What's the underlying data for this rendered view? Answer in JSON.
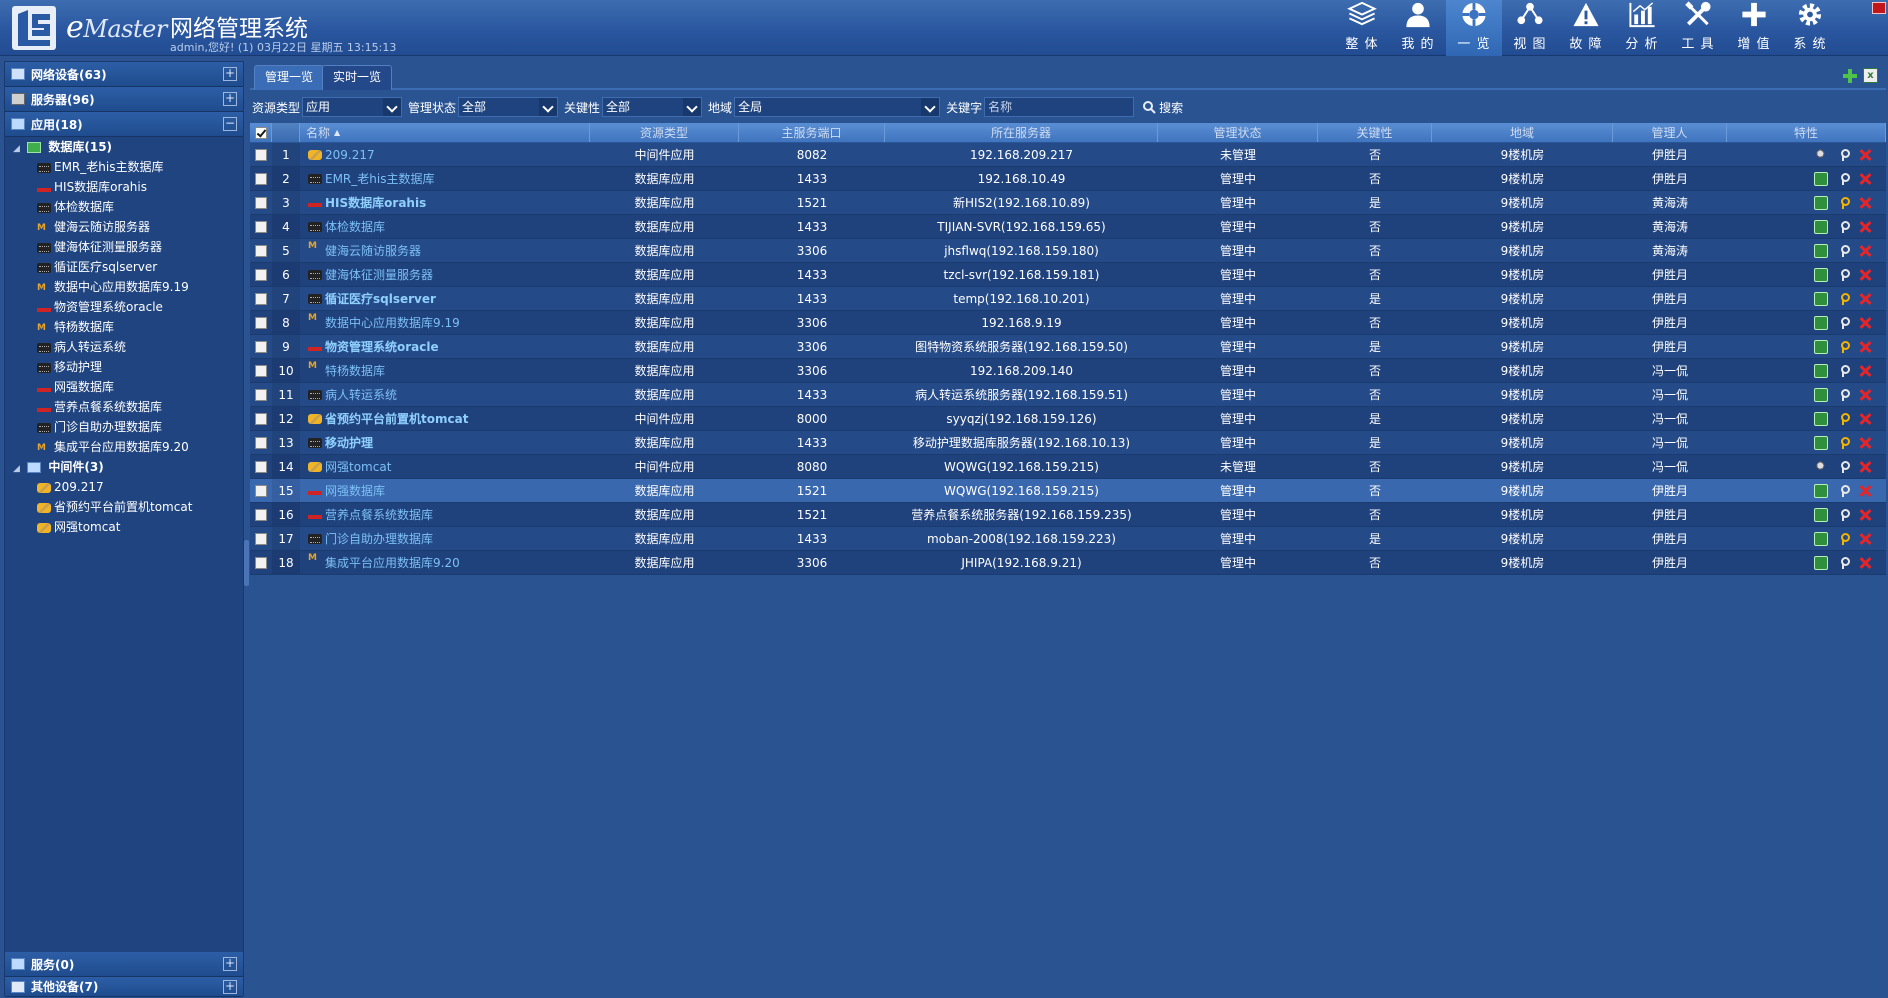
{
  "header": {
    "brand": "eMaster",
    "title": "网络管理系统",
    "subtitle": "admin,您好! (1) 03月22日 星期五 13:15:13",
    "nav": [
      {
        "label": "整 体",
        "icon": "layers-icon",
        "active": false
      },
      {
        "label": "我 的",
        "icon": "user-icon",
        "active": false
      },
      {
        "label": "一 览",
        "icon": "lifebuoy-icon",
        "active": true
      },
      {
        "label": "视 图",
        "icon": "topology-icon",
        "active": false
      },
      {
        "label": "故 障",
        "icon": "warning-icon",
        "active": false
      },
      {
        "label": "分 析",
        "icon": "chart-icon",
        "active": false
      },
      {
        "label": "工 具",
        "icon": "tools-icon",
        "active": false
      },
      {
        "label": "增 值",
        "icon": "plus-icon",
        "active": false
      },
      {
        "label": "系 统",
        "icon": "gear-icon",
        "active": false
      }
    ]
  },
  "sidebar": {
    "sections": {
      "network": "网络设备(63)",
      "servers": "服务器(96)",
      "apps": "应用(18)",
      "services": "服务(0)",
      "others": "其他设备(7)"
    },
    "db_group": "数据库(15)",
    "db_items": [
      {
        "label": "EMR_老his主数据库",
        "icon": "sqlserver"
      },
      {
        "label": "HIS数据库orahis",
        "icon": "oracle"
      },
      {
        "label": "体检数据库",
        "icon": "sqlserver"
      },
      {
        "label": "健海云随访服务器",
        "icon": "mysql"
      },
      {
        "label": "健海体征测量服务器",
        "icon": "sqlserver"
      },
      {
        "label": "循证医疗sqlserver",
        "icon": "sqlserver"
      },
      {
        "label": "数据中心应用数据库9.19",
        "icon": "mysql"
      },
      {
        "label": "物资管理系统oracle",
        "icon": "oracle"
      },
      {
        "label": "特杨数据库",
        "icon": "mysql"
      },
      {
        "label": "病人转运系统",
        "icon": "sqlserver"
      },
      {
        "label": "移动护理",
        "icon": "sqlserver"
      },
      {
        "label": "网强数据库",
        "icon": "oracle"
      },
      {
        "label": "营养点餐系统数据库",
        "icon": "oracle"
      },
      {
        "label": "门诊自助办理数据库",
        "icon": "sqlserver"
      },
      {
        "label": "集成平台应用数据库9.20",
        "icon": "mysql"
      }
    ],
    "mw_group": "中间件(3)",
    "mw_items": [
      {
        "label": "209.217",
        "icon": "tomcat"
      },
      {
        "label": "省预约平台前置机tomcat",
        "icon": "tomcat"
      },
      {
        "label": "网强tomcat",
        "icon": "tomcat"
      }
    ]
  },
  "tabs": [
    "管理一览",
    "实时一览"
  ],
  "filters": {
    "type_label": "资源类型",
    "type_value": "应用",
    "mgmt_label": "管理状态",
    "mgmt_value": "全部",
    "key_label": "关键性",
    "key_value": "全部",
    "region_label": "地域",
    "region_value": "全局",
    "keyword_label": "关键字",
    "keyword_placeholder": "名称",
    "search_label": "搜索"
  },
  "table": {
    "columns": [
      "名称",
      "资源类型",
      "主服务端口",
      "所在服务器",
      "管理状态",
      "关键性",
      "地域",
      "管理人",
      "特性"
    ],
    "rows": [
      {
        "no": "1",
        "name": "209.217",
        "icon": "tomcat",
        "type": "中间件应用",
        "port": "8082",
        "server": "192.168.209.217",
        "mgmt": "未管理",
        "key": "否",
        "region": "9楼机房",
        "owner": "伊胜月",
        "mon": "off",
        "keycolor": "white"
      },
      {
        "no": "2",
        "name": "EMR_老his主数据库",
        "icon": "sqlserver",
        "type": "数据库应用",
        "port": "1433",
        "server": "192.168.10.49",
        "mgmt": "管理中",
        "key": "否",
        "region": "9楼机房",
        "owner": "伊胜月",
        "mon": "on",
        "keycolor": "white"
      },
      {
        "no": "3",
        "name": "HIS数据库orahis",
        "icon": "oracle",
        "type": "数据库应用",
        "port": "1521",
        "server": "新HIS2(192.168.10.89)",
        "mgmt": "管理中",
        "key": "是",
        "region": "9楼机房",
        "owner": "黄海涛",
        "mon": "on",
        "keycolor": "gold",
        "strong": true
      },
      {
        "no": "4",
        "name": "体检数据库",
        "icon": "sqlserver",
        "type": "数据库应用",
        "port": "1433",
        "server": "TIJIAN-SVR(192.168.159.65)",
        "mgmt": "管理中",
        "key": "否",
        "region": "9楼机房",
        "owner": "黄海涛",
        "mon": "on",
        "keycolor": "white"
      },
      {
        "no": "5",
        "name": "健海云随访服务器",
        "icon": "mysql",
        "type": "数据库应用",
        "port": "3306",
        "server": "jhsflwq(192.168.159.180)",
        "mgmt": "管理中",
        "key": "否",
        "region": "9楼机房",
        "owner": "黄海涛",
        "mon": "on",
        "keycolor": "white"
      },
      {
        "no": "6",
        "name": "健海体征测量服务器",
        "icon": "sqlserver",
        "type": "数据库应用",
        "port": "1433",
        "server": "tzcl-svr(192.168.159.181)",
        "mgmt": "管理中",
        "key": "否",
        "region": "9楼机房",
        "owner": "伊胜月",
        "mon": "on",
        "keycolor": "white"
      },
      {
        "no": "7",
        "name": "循证医疗sqlserver",
        "icon": "sqlserver",
        "type": "数据库应用",
        "port": "1433",
        "server": "temp(192.168.10.201)",
        "mgmt": "管理中",
        "key": "是",
        "region": "9楼机房",
        "owner": "伊胜月",
        "mon": "on",
        "keycolor": "gold",
        "strong": true
      },
      {
        "no": "8",
        "name": "数据中心应用数据库9.19",
        "icon": "mysql",
        "type": "数据库应用",
        "port": "3306",
        "server": "192.168.9.19",
        "mgmt": "管理中",
        "key": "否",
        "region": "9楼机房",
        "owner": "伊胜月",
        "mon": "on",
        "keycolor": "white"
      },
      {
        "no": "9",
        "name": "物资管理系统oracle",
        "icon": "oracle",
        "type": "数据库应用",
        "port": "3306",
        "server": "图特物资系统服务器(192.168.159.50)",
        "mgmt": "管理中",
        "key": "是",
        "region": "9楼机房",
        "owner": "伊胜月",
        "mon": "on",
        "keycolor": "gold",
        "strong": true
      },
      {
        "no": "10",
        "name": "特杨数据库",
        "icon": "mysql",
        "type": "数据库应用",
        "port": "3306",
        "server": "192.168.209.140",
        "mgmt": "管理中",
        "key": "否",
        "region": "9楼机房",
        "owner": "冯一侃",
        "mon": "on",
        "keycolor": "white"
      },
      {
        "no": "11",
        "name": "病人转运系统",
        "icon": "sqlserver",
        "type": "数据库应用",
        "port": "1433",
        "server": "病人转运系统服务器(192.168.159.51)",
        "mgmt": "管理中",
        "key": "否",
        "region": "9楼机房",
        "owner": "冯一侃",
        "mon": "on",
        "keycolor": "white"
      },
      {
        "no": "12",
        "name": "省预约平台前置机tomcat",
        "icon": "tomcat",
        "type": "中间件应用",
        "port": "8000",
        "server": "syyqzj(192.168.159.126)",
        "mgmt": "管理中",
        "key": "是",
        "region": "9楼机房",
        "owner": "冯一侃",
        "mon": "on",
        "keycolor": "gold",
        "strong": true
      },
      {
        "no": "13",
        "name": "移动护理",
        "icon": "sqlserver",
        "type": "数据库应用",
        "port": "1433",
        "server": "移动护理数据库服务器(192.168.10.13)",
        "mgmt": "管理中",
        "key": "是",
        "region": "9楼机房",
        "owner": "冯一侃",
        "mon": "on",
        "keycolor": "gold",
        "strong": true
      },
      {
        "no": "14",
        "name": "网强tomcat",
        "icon": "tomcat",
        "type": "中间件应用",
        "port": "8080",
        "server": "WQWG(192.168.159.215)",
        "mgmt": "未管理",
        "key": "否",
        "region": "9楼机房",
        "owner": "冯一侃",
        "mon": "off",
        "keycolor": "white"
      },
      {
        "no": "15",
        "name": "网强数据库",
        "icon": "oracle",
        "type": "数据库应用",
        "port": "1521",
        "server": "WQWG(192.168.159.215)",
        "mgmt": "管理中",
        "key": "否",
        "region": "9楼机房",
        "owner": "伊胜月",
        "mon": "on",
        "keycolor": "white"
      },
      {
        "no": "16",
        "name": "营养点餐系统数据库",
        "icon": "oracle",
        "type": "数据库应用",
        "port": "1521",
        "server": "营养点餐系统服务器(192.168.159.235)",
        "mgmt": "管理中",
        "key": "否",
        "region": "9楼机房",
        "owner": "伊胜月",
        "mon": "on",
        "keycolor": "white"
      },
      {
        "no": "17",
        "name": "门诊自助办理数据库",
        "icon": "sqlserver",
        "type": "数据库应用",
        "port": "1433",
        "server": "moban-2008(192.168.159.223)",
        "mgmt": "管理中",
        "key": "是",
        "region": "9楼机房",
        "owner": "伊胜月",
        "mon": "on",
        "keycolor": "gold"
      },
      {
        "no": "18",
        "name": "集成平台应用数据库9.20",
        "icon": "mysql",
        "type": "数据库应用",
        "port": "3306",
        "server": "JHIPA(192.168.9.21)",
        "mgmt": "管理中",
        "key": "否",
        "region": "9楼机房",
        "owner": "伊胜月",
        "mon": "on",
        "keycolor": "white"
      }
    ]
  }
}
